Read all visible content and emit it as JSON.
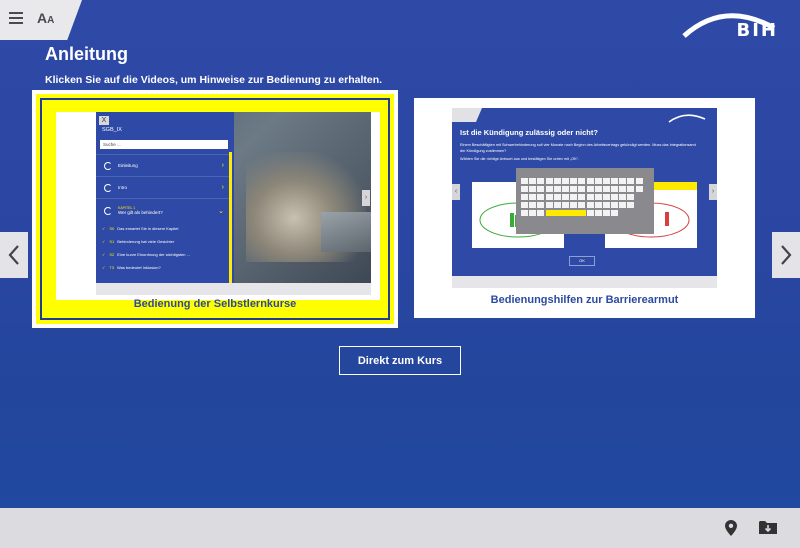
{
  "header": {
    "menu_icon": "hamburger-icon",
    "font_icon": "font-size-icon",
    "font_label_big": "A",
    "font_label_small": "A",
    "logo_text": "BIH"
  },
  "page": {
    "title": "Anleitung",
    "subtitle": "Klicken Sie auf die Videos, um Hinweise zur Bedienung zu erhalten."
  },
  "carousel": {
    "prev_icon": "chevron-left-icon",
    "next_icon": "chevron-right-icon",
    "cards": [
      {
        "caption": "Bedienung der Selbstlernkurse",
        "selected": true,
        "preview": {
          "close": "X",
          "course": "SGB_IX",
          "search_placeholder": "Suche ...",
          "items": [
            "Einleitung",
            "Intro"
          ],
          "chapter_label": "KAPITEL 1",
          "chapter_title": "Wer gilt als behindert?",
          "lessons": [
            {
              "num": "S0",
              "label": "Das erwartet Sie in diesem Kapitel"
            },
            {
              "num": "S1",
              "label": "Behinderung hat viele Gesichter"
            },
            {
              "num": "S2",
              "label": "Eine kurze Einordnung der wichtigsten ..."
            },
            {
              "num": "T3",
              "label": "Was bedeutet Inklusion?"
            }
          ]
        }
      },
      {
        "caption": "Bedienungshilfen zur Barrierearmut",
        "selected": false,
        "preview": {
          "title": "Ist die Kündigung zulässig oder nicht?",
          "text": "Einem Beschäftigten mit Schwerbehinderung soll vier Monate nach Beginn des Arbeitsvertrags gekündigt werden. Muss das Integrationsamt der Kündigung zustimmen?",
          "instruction": "Wählen Sie die richtige Antwort aus und bestätigen Sie unten mit „OK“.",
          "ok": "OK"
        }
      }
    ]
  },
  "actions": {
    "direct_button": "Direkt zum Kurs"
  },
  "footer": {
    "location_icon": "map-pin-icon",
    "download_icon": "folder-download-icon"
  },
  "colors": {
    "background": "#2a46a2",
    "highlight": "#ffff00",
    "caption_text": "#2c4aa0"
  }
}
